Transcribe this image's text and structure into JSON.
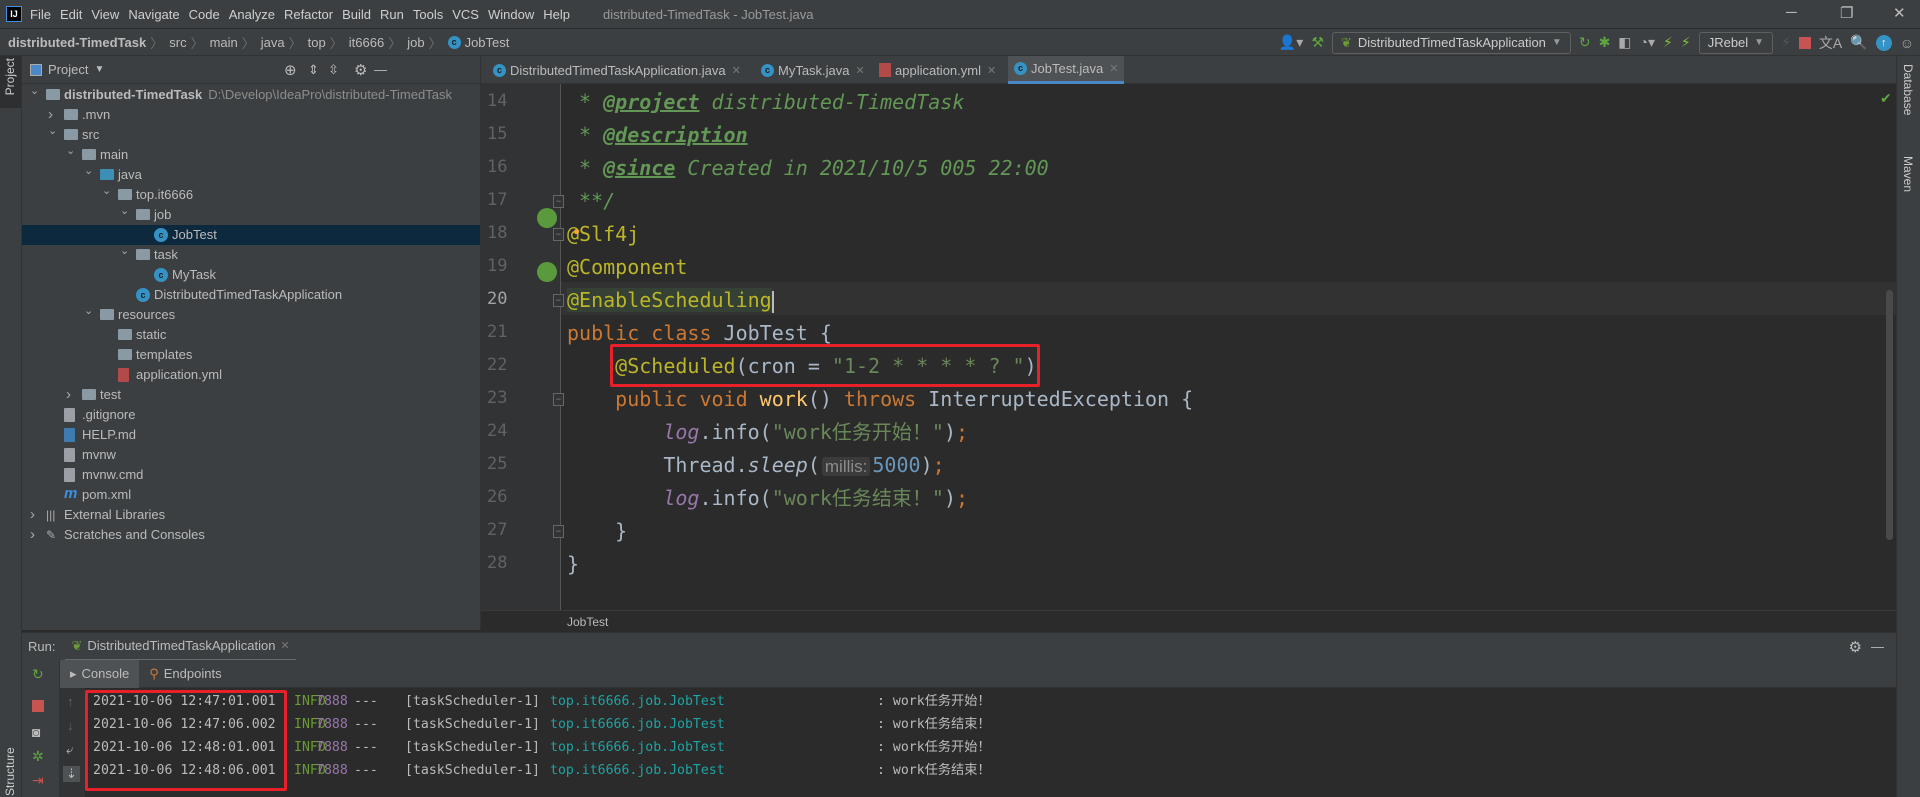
{
  "window": {
    "title": "distributed-TimedTask - JobTest.java",
    "logo": "IJ"
  },
  "menu": [
    "File",
    "Edit",
    "View",
    "Navigate",
    "Code",
    "Analyze",
    "Refactor",
    "Build",
    "Run",
    "Tools",
    "VCS",
    "Window",
    "Help"
  ],
  "breadcrumb": [
    "distributed-TimedTask",
    "src",
    "main",
    "java",
    "top",
    "it6666",
    "job",
    "JobTest"
  ],
  "toolbar": {
    "run_config": "DistributedTimedTaskApplication",
    "jrebel": "JRebel",
    "icons": [
      "user-icon",
      "build-hammer-icon",
      "rerun-icon",
      "debug-bug-icon",
      "coverage-icon",
      "profile-icon",
      "jrebel-run-icon",
      "jrebel-debug-icon",
      "stop-icon",
      "translate-icon",
      "search-icon",
      "update-icon",
      "avatar-icon"
    ]
  },
  "left_stripe": {
    "project": "Project",
    "structure": "Structure"
  },
  "right_stripe": {
    "database": "Database",
    "maven": "Maven"
  },
  "project_panel": {
    "title": "Project",
    "tree": [
      {
        "level": 0,
        "arrow": "down",
        "icon": "module",
        "label": "distributed-TimedTask",
        "path": "D:\\Develop\\IdeaPro\\distributed-TimedTask",
        "bold": true
      },
      {
        "level": 1,
        "arrow": "right",
        "icon": "folder",
        "label": ".mvn"
      },
      {
        "level": 1,
        "arrow": "down",
        "icon": "folder",
        "label": "src"
      },
      {
        "level": 2,
        "arrow": "down",
        "icon": "folder",
        "label": "main"
      },
      {
        "level": 3,
        "arrow": "down",
        "icon": "folder-blue",
        "label": "java"
      },
      {
        "level": 4,
        "arrow": "down",
        "icon": "package",
        "label": "top.it6666"
      },
      {
        "level": 5,
        "arrow": "down",
        "icon": "package",
        "label": "job"
      },
      {
        "level": 6,
        "arrow": "",
        "icon": "class",
        "label": "JobTest",
        "selected": true
      },
      {
        "level": 5,
        "arrow": "down",
        "icon": "package",
        "label": "task"
      },
      {
        "level": 6,
        "arrow": "",
        "icon": "class",
        "label": "MyTask"
      },
      {
        "level": 5,
        "arrow": "",
        "icon": "spring-class",
        "label": "DistributedTimedTaskApplication"
      },
      {
        "level": 3,
        "arrow": "down",
        "icon": "folder-res",
        "label": "resources"
      },
      {
        "level": 4,
        "arrow": "",
        "icon": "folder",
        "label": "static"
      },
      {
        "level": 4,
        "arrow": "",
        "icon": "folder",
        "label": "templates"
      },
      {
        "level": 4,
        "arrow": "",
        "icon": "yml",
        "label": "application.yml"
      },
      {
        "level": 2,
        "arrow": "right",
        "icon": "folder",
        "label": "test"
      },
      {
        "level": 1,
        "arrow": "",
        "icon": "file",
        "label": ".gitignore"
      },
      {
        "level": 1,
        "arrow": "",
        "icon": "md",
        "label": "HELP.md"
      },
      {
        "level": 1,
        "arrow": "",
        "icon": "file",
        "label": "mvnw"
      },
      {
        "level": 1,
        "arrow": "",
        "icon": "file",
        "label": "mvnw.cmd"
      },
      {
        "level": 1,
        "arrow": "",
        "icon": "maven",
        "label": "pom.xml"
      },
      {
        "level": 0,
        "arrow": "right",
        "icon": "library",
        "label": "External Libraries"
      },
      {
        "level": 0,
        "arrow": "right",
        "icon": "scratch",
        "label": "Scratches and Consoles"
      }
    ]
  },
  "tabs": [
    {
      "label": "DistributedTimedTaskApplication.java",
      "icon": "spring-class"
    },
    {
      "label": "MyTask.java",
      "icon": "class"
    },
    {
      "label": "application.yml",
      "icon": "yml"
    },
    {
      "label": "JobTest.java",
      "icon": "class",
      "active": true
    }
  ],
  "editor": {
    "current_line": 20,
    "breadcrumb": "JobTest",
    "lines": [
      {
        "n": 14,
        "tokens": [
          [
            " * ",
            "cm"
          ],
          [
            "@project",
            "tag"
          ],
          [
            " distributed-TimedTask",
            "cm"
          ]
        ]
      },
      {
        "n": 15,
        "tokens": [
          [
            " * ",
            "cm"
          ],
          [
            "@description",
            "tag"
          ]
        ]
      },
      {
        "n": 16,
        "tokens": [
          [
            " * ",
            "cm"
          ],
          [
            "@since",
            "tag"
          ],
          [
            " Created in 2021/10/5 005 22:00",
            "cm"
          ]
        ]
      },
      {
        "n": 17,
        "tokens": [
          [
            " **/",
            "cm"
          ]
        ]
      },
      {
        "n": 18,
        "tokens": [
          [
            "@Slf4j",
            "an"
          ]
        ]
      },
      {
        "n": 19,
        "tokens": [
          [
            "@Component",
            "an"
          ]
        ]
      },
      {
        "n": 20,
        "tokens": [
          [
            "@EnableScheduling",
            "an hl"
          ]
        ]
      },
      {
        "n": 21,
        "tokens": [
          [
            "public class ",
            "kw"
          ],
          [
            "JobTest {",
            ""
          ]
        ]
      },
      {
        "n": 22,
        "tokens": [
          [
            "    ",
            ""
          ],
          [
            "@Scheduled",
            "an"
          ],
          [
            "(cron = ",
            ""
          ],
          [
            "\"1-2 * * * * ? \"",
            "st"
          ],
          [
            ")",
            ""
          ]
        ]
      },
      {
        "n": 23,
        "tokens": [
          [
            "    public void ",
            "kw"
          ],
          [
            "work",
            "mt"
          ],
          [
            "() ",
            ""
          ],
          [
            "throws ",
            "kw"
          ],
          [
            "InterruptedException {",
            ""
          ]
        ]
      },
      {
        "n": 24,
        "tokens": [
          [
            "        ",
            ""
          ],
          [
            "log",
            "fd"
          ],
          [
            ".info(",
            ""
          ],
          [
            "\"work任务开始！\"",
            "st"
          ],
          [
            ")",
            ""
          ],
          [
            ";",
            "kw"
          ]
        ]
      },
      {
        "n": 25,
        "tokens": [
          [
            "        Thread.",
            ""
          ],
          [
            "sleep",
            "it"
          ],
          [
            "(",
            ""
          ],
          [
            "millis:",
            "hint"
          ],
          [
            "5000",
            "nm"
          ],
          [
            ")",
            ""
          ],
          [
            ";",
            "kw"
          ]
        ]
      },
      {
        "n": 26,
        "tokens": [
          [
            "        ",
            ""
          ],
          [
            "log",
            "fd"
          ],
          [
            ".info(",
            ""
          ],
          [
            "\"work任务结束！\"",
            "st"
          ],
          [
            ")",
            ""
          ],
          [
            ";",
            "kw"
          ]
        ]
      },
      {
        "n": 27,
        "tokens": [
          [
            "    }",
            ""
          ]
        ]
      },
      {
        "n": 28,
        "tokens": [
          [
            "}",
            ""
          ]
        ]
      }
    ]
  },
  "run": {
    "label": "Run:",
    "config": "DistributedTimedTaskApplication",
    "tabs": [
      "Console",
      "Endpoints"
    ],
    "log": [
      {
        "time": "2021-10-06 12:47:01.001",
        "level": "INFO",
        "pid": "7888",
        "sep": "---",
        "thread": "[taskScheduler-1]",
        "logger": "top.it6666.job.JobTest",
        "msg": ": work任务开始！"
      },
      {
        "time": "2021-10-06 12:47:06.002",
        "level": "INFO",
        "pid": "7888",
        "sep": "---",
        "thread": "[taskScheduler-1]",
        "logger": "top.it6666.job.JobTest",
        "msg": ": work任务结束！"
      },
      {
        "time": "2021-10-06 12:48:01.001",
        "level": "INFO",
        "pid": "7888",
        "sep": "---",
        "thread": "[taskScheduler-1]",
        "logger": "top.it6666.job.JobTest",
        "msg": ": work任务开始！"
      },
      {
        "time": "2021-10-06 12:48:06.001",
        "level": "INFO",
        "pid": "7888",
        "sep": "---",
        "thread": "[taskScheduler-1]",
        "logger": "top.it6666.job.JobTest",
        "msg": ": work任务结束！"
      }
    ]
  },
  "colors": {
    "highlight_box": "#e8202a",
    "accent": "#4a88c7",
    "selection": "#0d293e"
  }
}
